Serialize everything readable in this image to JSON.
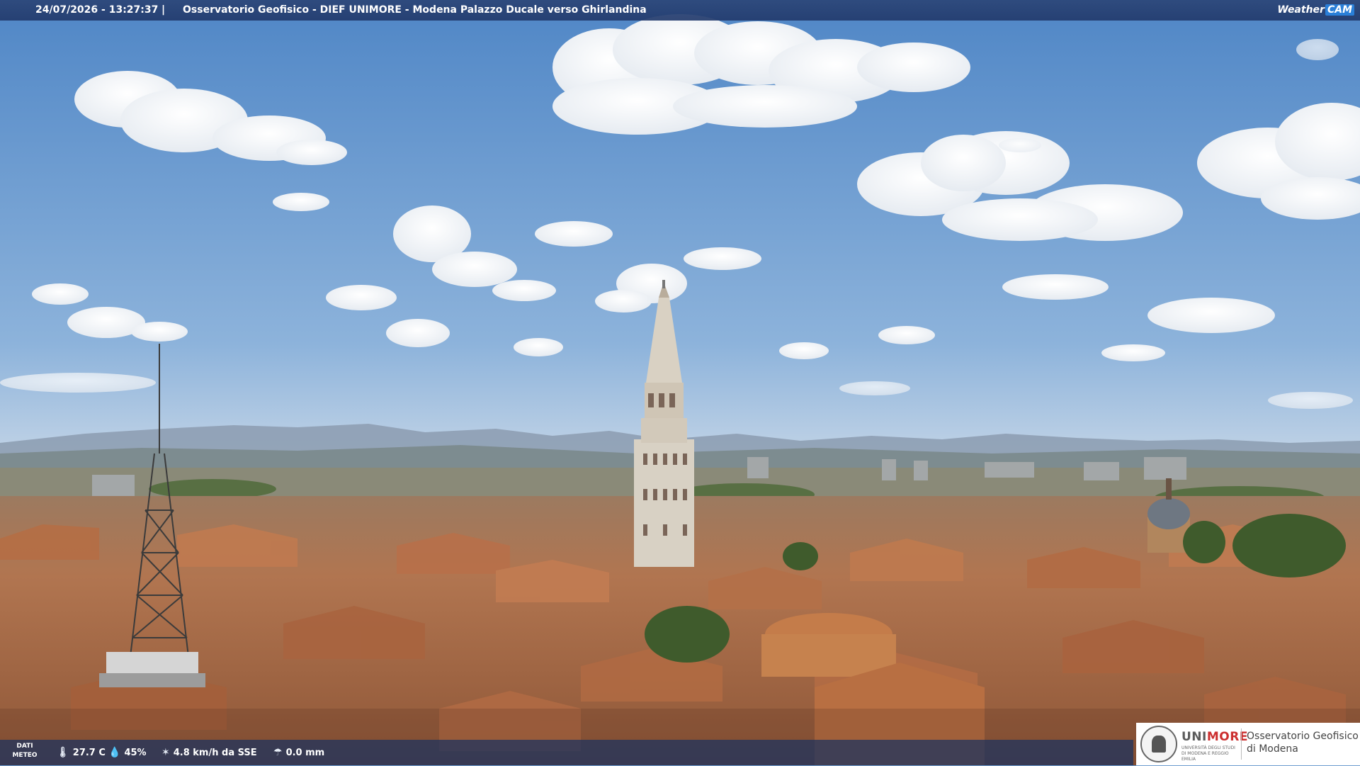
{
  "overlay": {
    "timestamp": "24/07/2026 - 13:27:37",
    "separator": "|",
    "title": "Osservatorio Geofisico - DIEF UNIMORE - Modena Palazzo Ducale verso Ghirlandina",
    "brand_prefix": "Weather",
    "brand_suffix": "CAM"
  },
  "weather": {
    "label_line1": "DATI",
    "label_line2": "METEO",
    "temperature": "27.7 C",
    "humidity": "45%",
    "wind": "4.8 km/h da SSE",
    "rain": "0.0 mm",
    "icons": [
      "thermometer-icon",
      "droplet-icon",
      "wind-icon",
      "rain-gauge-icon"
    ]
  },
  "logo": {
    "uni_part1": "UNI",
    "uni_part2": "MORE",
    "uni_sub": "UNIVERSITÀ DEGLI STUDI DI MODENA E REGGIO EMILIA",
    "obs_line1": "Osservatorio Geofisico",
    "obs_line2": "di Modena"
  },
  "colors": {
    "sky_top": "#5c8fcb",
    "sky_bottom": "#c8d6e6",
    "roofs": "#b07048",
    "bar": "#2c4678",
    "brand_accent": "#2a7fd8",
    "unimore_red": "#cc2f2f"
  }
}
